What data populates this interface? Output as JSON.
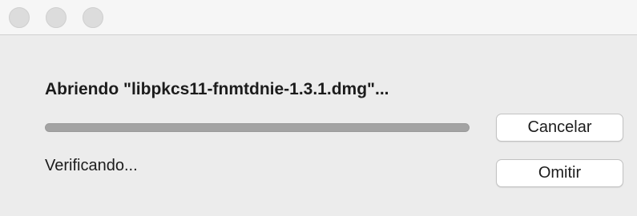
{
  "window": {
    "controls": [
      "close",
      "minimize",
      "zoom"
    ]
  },
  "dialog": {
    "title": "Abriendo \"libpkcs11-fnmtdnie-1.3.1.dmg\"...",
    "status": "Verificando...",
    "progress": 1.0
  },
  "buttons": {
    "cancel_label": "Cancelar",
    "skip_label": "Omitir"
  },
  "colors": {
    "background": "#ececec",
    "progress_track": "#a8a8a8"
  }
}
